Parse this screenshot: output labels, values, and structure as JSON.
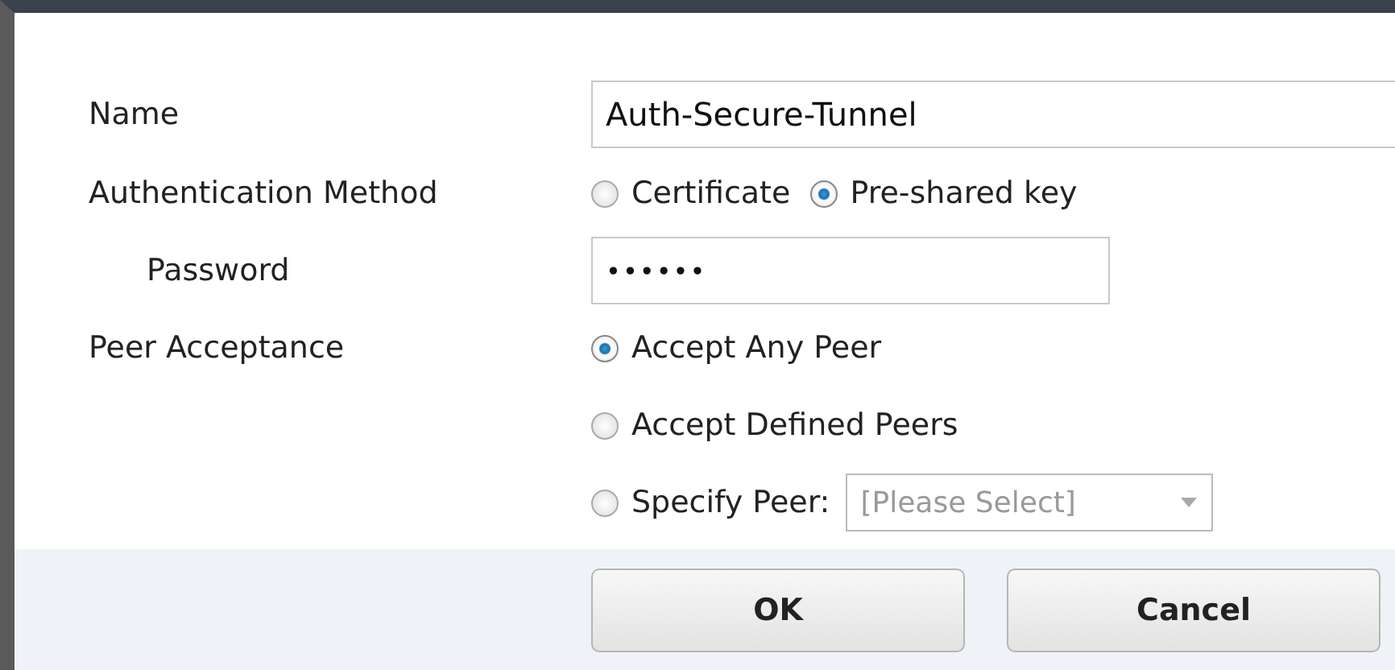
{
  "form": {
    "name": {
      "label": "Name",
      "value": "Auth-Secure-Tunnel"
    },
    "authentication_method": {
      "label": "Authentication Method",
      "options": [
        {
          "label": "Certificate",
          "selected": false
        },
        {
          "label": "Pre-shared key",
          "selected": true
        }
      ]
    },
    "password": {
      "label": "Password",
      "value": "••••••"
    },
    "peer_acceptance": {
      "label": "Peer Acceptance",
      "options": [
        {
          "label": "Accept Any Peer",
          "selected": true,
          "kind": "plain"
        },
        {
          "label": "Accept Defined Peers",
          "selected": false,
          "kind": "plain"
        },
        {
          "label": "Specify Peer:",
          "selected": false,
          "kind": "select",
          "placeholder": "[Please Select]"
        }
      ]
    }
  },
  "buttons": [
    {
      "label": "OK"
    },
    {
      "label": "Cancel"
    }
  ]
}
